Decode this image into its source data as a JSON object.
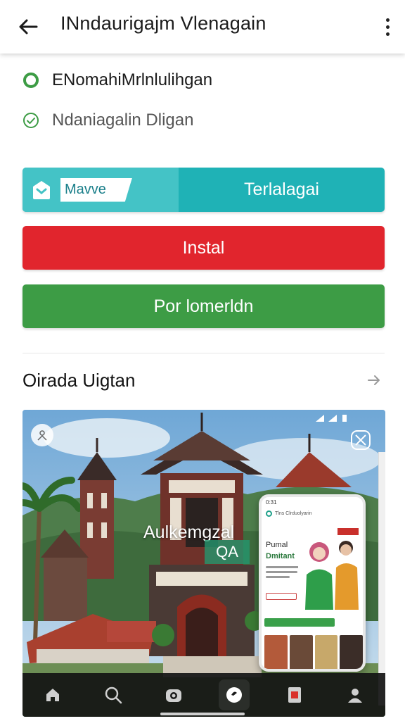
{
  "header": {
    "title": "INndaurigajm Vlenagain",
    "back_icon": "arrow-left-icon",
    "menu_icon": "more-vertical-icon"
  },
  "info": [
    {
      "icon": "radio-circle-icon",
      "label": "ENomahiMrlnlulihgan",
      "color": "#3d9c45"
    },
    {
      "icon": "check-circle-icon",
      "label": "Ndaniagalin Dligan",
      "color": "#3d9c45"
    }
  ],
  "buttons": {
    "split": {
      "tag_label": "Mavve",
      "main_label": "Terlalagai",
      "color": "#1fb2b6"
    },
    "install": {
      "label": "Instal",
      "color": "#e1252d"
    },
    "secondary": {
      "label": "Por lomerldn",
      "color": "#3d9c45"
    }
  },
  "section": {
    "title": "Oirada Uigtan",
    "arrow_icon": "arrow-right-icon"
  },
  "media": {
    "overlay_text": "Aulkemgzal",
    "overlay_badge": "QA",
    "phone": {
      "status": "0:31",
      "header": "Tlns Clrduolyarin",
      "title": "Pumal",
      "subtitle": "Dmitant"
    }
  },
  "bottom_nav": [
    {
      "icon": "home-icon",
      "active": false
    },
    {
      "icon": "search-icon",
      "active": false
    },
    {
      "icon": "camera-icon",
      "active": false
    },
    {
      "icon": "discover-icon",
      "active": true
    },
    {
      "icon": "library-icon",
      "active": false
    },
    {
      "icon": "profile-icon",
      "active": false
    }
  ]
}
